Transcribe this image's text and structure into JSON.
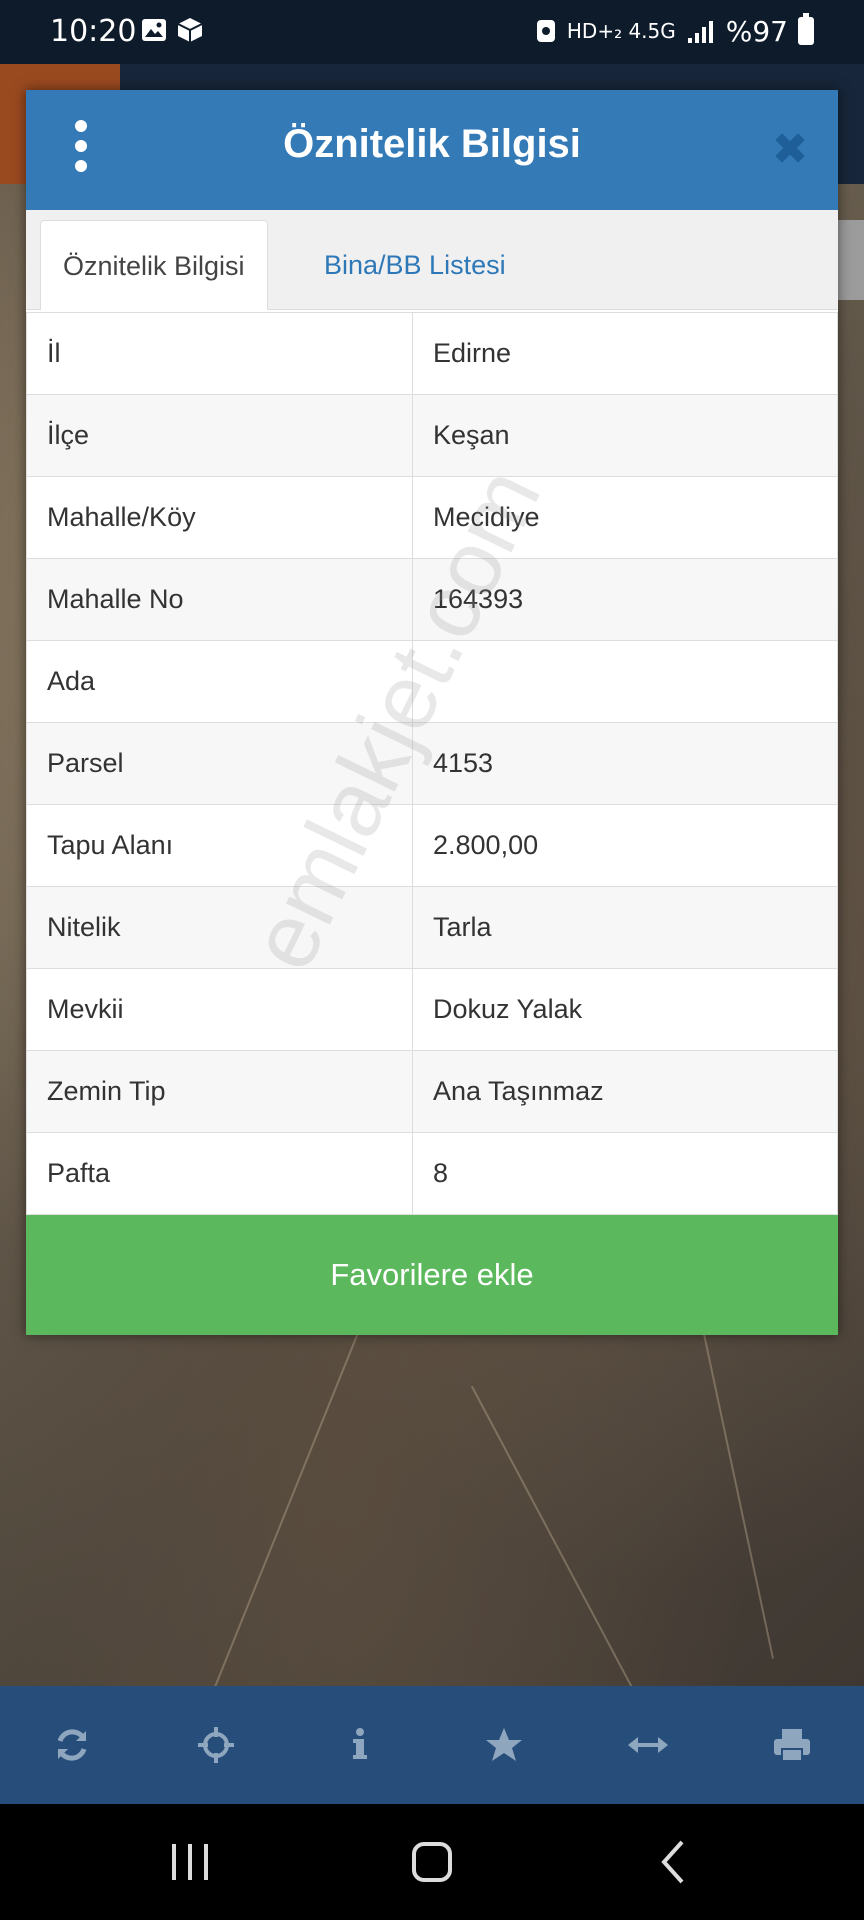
{
  "status": {
    "time": "10:20",
    "network": "HD+₂ 4.5G",
    "battery": "%97"
  },
  "modal": {
    "title": "Öznitelik Bilgisi",
    "tabs": [
      {
        "label": "Öznitelik Bilgisi",
        "active": true
      },
      {
        "label": "Bina/BB Listesi",
        "active": false
      }
    ],
    "rows": [
      {
        "key": "İl",
        "value": "Edirne"
      },
      {
        "key": "İlçe",
        "value": "Keşan"
      },
      {
        "key": "Mahalle/Köy",
        "value": "Mecidiye"
      },
      {
        "key": "Mahalle No",
        "value": "164393"
      },
      {
        "key": "Ada",
        "value": ""
      },
      {
        "key": "Parsel",
        "value": "4153"
      },
      {
        "key": "Tapu Alanı",
        "value": "2.800,00"
      },
      {
        "key": "Nitelik",
        "value": "Tarla"
      },
      {
        "key": "Mevkii",
        "value": "Dokuz Yalak"
      },
      {
        "key": "Zemin Tip",
        "value": "Ana Taşınmaz"
      },
      {
        "key": "Pafta",
        "value": "8"
      }
    ],
    "favorite_label": "Favorilere ekle"
  },
  "watermark": "emlakjet.com",
  "toolbar": {
    "icons": [
      "refresh-icon",
      "crosshair-icon",
      "info-icon",
      "star-icon",
      "measure-icon",
      "print-icon"
    ],
    "icon_color": "#8fa6bf"
  },
  "colors": {
    "header": "#337ab7",
    "favorite": "#5cb85c",
    "toolbar": "#274d7a",
    "tab_link": "#2e78b8"
  }
}
